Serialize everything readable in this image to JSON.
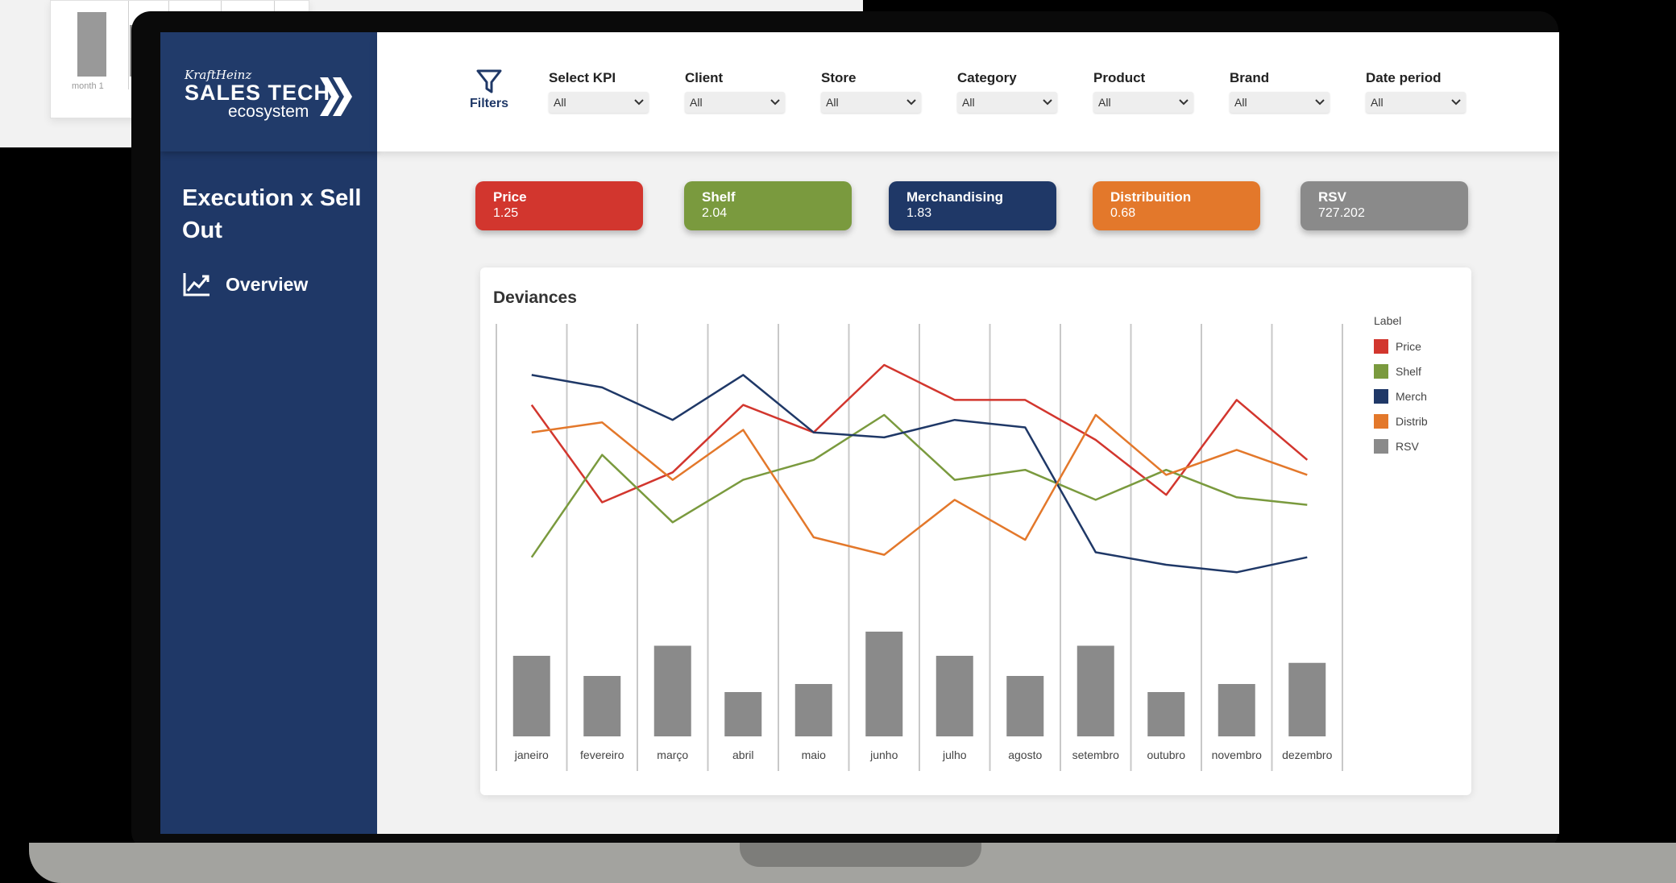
{
  "background": {
    "month_label": "month 1"
  },
  "logo": {
    "brand": "KraftHeinz",
    "title": "SALES TECH",
    "subtitle": "ecosystem"
  },
  "sidebar": {
    "page_title": "Execution x Sell Out",
    "nav": [
      {
        "label": "Overview",
        "icon": "line-chart-icon"
      }
    ]
  },
  "filterbar": {
    "filters_label": "Filters",
    "filters": [
      {
        "label": "Select KPI",
        "value": "All"
      },
      {
        "label": "Client",
        "value": "All"
      },
      {
        "label": "Store",
        "value": "All"
      },
      {
        "label": "Category",
        "value": "All"
      },
      {
        "label": "Product",
        "value": "All"
      },
      {
        "label": "Brand",
        "value": "All"
      },
      {
        "label": "Date period",
        "value": "All"
      }
    ]
  },
  "kpis": [
    {
      "name": "Price",
      "value": "1.25",
      "color": "#d2362e"
    },
    {
      "name": "Shelf",
      "value": "2.04",
      "color": "#7a9a3e"
    },
    {
      "name": "Merchandising",
      "value": "1.83",
      "color": "#1f3867"
    },
    {
      "name": "Distribuition",
      "value": "0.68",
      "color": "#e3782b"
    },
    {
      "name": "RSV",
      "value": "727.202",
      "color": "#8a8a8a"
    }
  ],
  "chart": {
    "title": "Deviances",
    "legend_title": "Label"
  },
  "chart_data": {
    "type": "line",
    "categories": [
      "janeiro",
      "fevereiro",
      "março",
      "abril",
      "maio",
      "junho",
      "julho",
      "agosto",
      "setembro",
      "outubro",
      "novembro",
      "dezembro"
    ],
    "series": [
      {
        "name": "Price",
        "kind": "line",
        "color": "#d2362e",
        "values": [
          74,
          35,
          47,
          74,
          63,
          90,
          76,
          76,
          60,
          38,
          76,
          52
        ]
      },
      {
        "name": "Shelf",
        "kind": "line",
        "color": "#7a9a3e",
        "values": [
          13,
          54,
          27,
          44,
          52,
          70,
          44,
          48,
          36,
          48,
          37,
          34
        ]
      },
      {
        "name": "Merch",
        "kind": "line",
        "color": "#1f3867",
        "values": [
          86,
          81,
          68,
          86,
          63,
          61,
          68,
          65,
          15,
          10,
          7,
          13
        ]
      },
      {
        "name": "Distrib",
        "kind": "line",
        "color": "#e3782b",
        "values": [
          63,
          67,
          44,
          64,
          21,
          14,
          36,
          20,
          70,
          46,
          56,
          46
        ]
      },
      {
        "name": "RSV",
        "kind": "bar",
        "color": "#8a8a8a",
        "values": [
          80,
          60,
          90,
          44,
          52,
          104,
          80,
          60,
          90,
          44,
          52,
          73
        ]
      }
    ]
  }
}
